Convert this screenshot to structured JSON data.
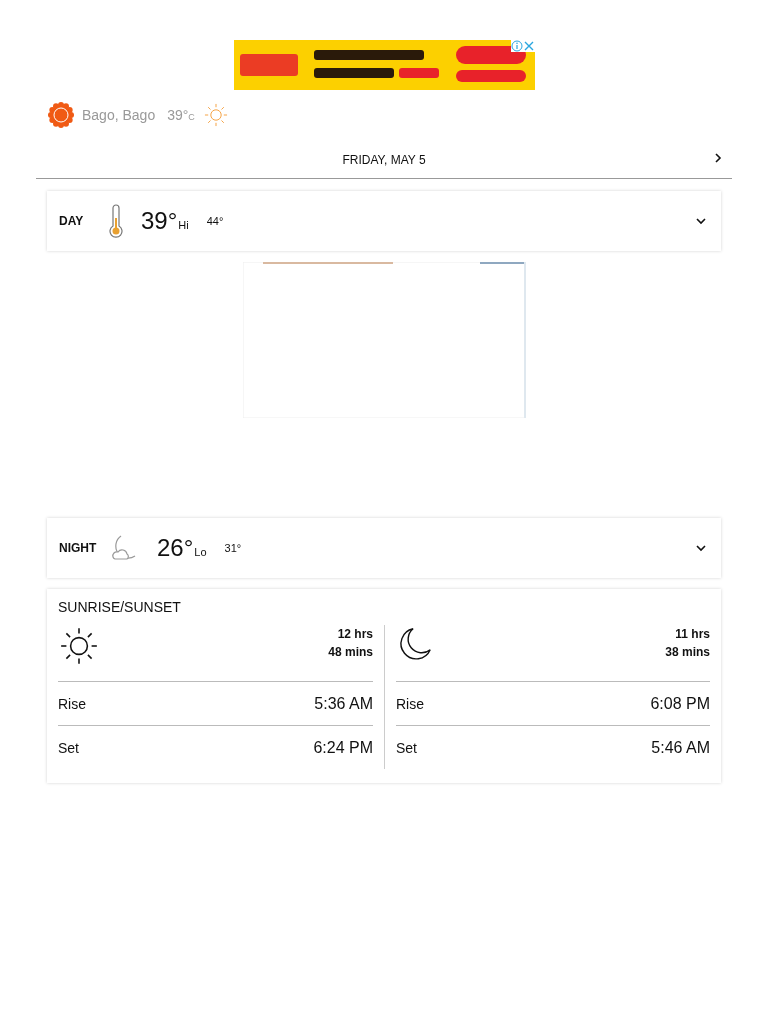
{
  "location": {
    "name": "Bago, Bago",
    "temperature": "39°",
    "unit": "C"
  },
  "date_header": {
    "title": "FRIDAY, MAY 5"
  },
  "periods": [
    {
      "kind": "day",
      "label": "DAY",
      "temperature": "39°",
      "qualifier": "Hi",
      "feels_like": "44°",
      "expanded": false
    },
    {
      "kind": "night",
      "label": "NIGHT",
      "temperature": "26°",
      "qualifier": "Lo",
      "feels_like": "31°",
      "expanded": false
    }
  ],
  "sunrise_sunset": {
    "title": "SUNRISE/SUNSET",
    "columns": [
      {
        "kind": "sun",
        "duration_hours": "12 hrs",
        "duration_minutes": "48 mins",
        "rows": [
          {
            "label": "Rise",
            "time": "5:36 AM"
          },
          {
            "label": "Set",
            "time": "6:24 PM"
          }
        ]
      },
      {
        "kind": "moon",
        "duration_hours": "11 hrs",
        "duration_minutes": "38 mins",
        "rows": [
          {
            "label": "Rise",
            "time": "6:08 PM"
          },
          {
            "label": "Set",
            "time": "5:46 AM"
          }
        ]
      }
    ]
  }
}
